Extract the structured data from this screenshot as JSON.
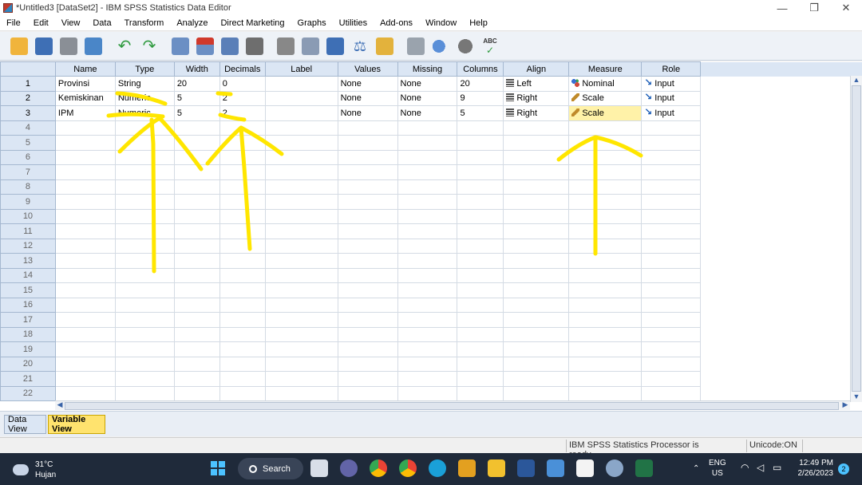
{
  "window": {
    "title": "*Untitled3 [DataSet2] - IBM SPSS Statistics Data Editor",
    "controls": [
      "—",
      "❐",
      "✕"
    ]
  },
  "menu": [
    "File",
    "Edit",
    "View",
    "Data",
    "Transform",
    "Analyze",
    "Direct Marketing",
    "Graphs",
    "Utilities",
    "Add-ons",
    "Window",
    "Help"
  ],
  "toolbar": {
    "icons": [
      "open-icon",
      "save-icon",
      "print-icon",
      "dialog-recall-icon",
      "undo-icon",
      "redo-icon",
      "goto-case-icon",
      "goto-variable-icon",
      "variables-icon",
      "find-icon",
      "insert-cases-icon",
      "insert-variable-icon",
      "split-file-icon",
      "weight-cases-icon",
      "select-cases-icon",
      "value-labels-icon",
      "use-variable-sets-icon",
      "show-all-variables-icon",
      "spell-check-icon"
    ],
    "spell_label": "ABC"
  },
  "grid": {
    "columns": [
      "Name",
      "Type",
      "Width",
      "Decimals",
      "Label",
      "Values",
      "Missing",
      "Columns",
      "Align",
      "Measure",
      "Role"
    ],
    "rows": [
      {
        "n": "1",
        "name": "Provinsi",
        "type": "String",
        "width": "20",
        "decimals": "0",
        "label": "",
        "values": "None",
        "missing": "None",
        "columns": "20",
        "align": "Left",
        "measure": "Nominal",
        "role": "Input"
      },
      {
        "n": "2",
        "name": "Kemiskinan",
        "type": "Numeric",
        "width": "5",
        "decimals": "2",
        "label": "",
        "values": "None",
        "missing": "None",
        "columns": "9",
        "align": "Right",
        "measure": "Scale",
        "role": "Input"
      },
      {
        "n": "3",
        "name": "IPM",
        "type": "Numeric",
        "width": "5",
        "decimals": "2",
        "label": "",
        "values": "None",
        "missing": "None",
        "columns": "5",
        "align": "Right",
        "measure": "Scale",
        "role": "Input"
      }
    ],
    "empty_rows": [
      "4",
      "5",
      "6",
      "7",
      "8",
      "9",
      "10",
      "11",
      "12",
      "13",
      "14",
      "15",
      "16",
      "17",
      "18",
      "19",
      "20",
      "21",
      "22"
    ]
  },
  "tabs": {
    "data_view": "Data View",
    "variable_view": "Variable View"
  },
  "status": {
    "processor": "IBM SPSS Statistics Processor is ready",
    "unicode": "Unicode:ON"
  },
  "taskbar": {
    "temperature": "31°C",
    "weather": "Hujan",
    "search_label": "Search",
    "lang_top": "ENG",
    "lang_bottom": "US",
    "time": "12:49 PM",
    "date": "2/26/2023",
    "notifications": "2"
  },
  "colors": {
    "annotation": "#ffe600",
    "selected_cell": "#fff2a8",
    "header_bg": "#dbe6f4"
  }
}
